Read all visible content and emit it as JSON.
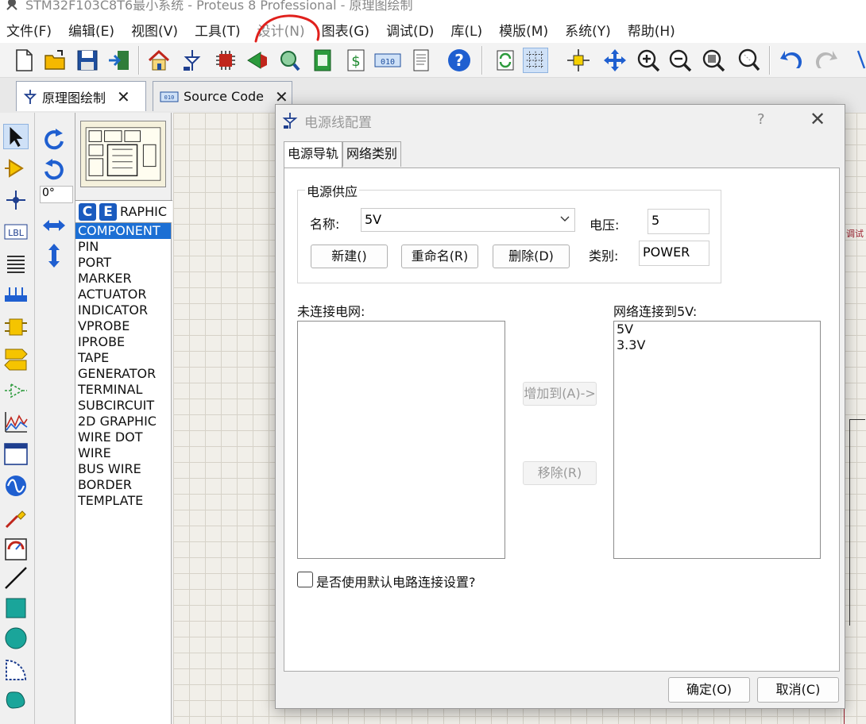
{
  "window": {
    "title": "STM32F103C8T6最小系统 - Proteus 8 Professional - 原理图绘制"
  },
  "menu": [
    "文件(F)",
    "编辑(E)",
    "视图(V)",
    "工具(T)",
    "设计(N)",
    "图表(G)",
    "调试(D)",
    "库(L)",
    "模版(M)",
    "系统(Y)",
    "帮助(H)"
  ],
  "toolbar": {
    "icons": [
      "new-file-icon",
      "open-folder-icon",
      "save-icon",
      "import-icon",
      "home-icon",
      "schematic-icon",
      "pcb-icon",
      "3d-viewer-icon",
      "gerber-icon",
      "design-explorer-icon",
      "bill-of-materials-icon",
      "source-code-icon",
      "notes-icon",
      "help-icon",
      "refresh-icon",
      "grid-icon",
      "origin-icon",
      "pan-icon",
      "zoom-in-icon",
      "zoom-out-icon",
      "zoom-all-icon",
      "zoom-area-icon",
      "undo-icon",
      "redo-icon",
      "cut-icon"
    ]
  },
  "tabs": [
    {
      "label": "原理图绘制",
      "active": true
    },
    {
      "label": "Source Code",
      "active": false
    }
  ],
  "sidebar": {
    "angle": "0°"
  },
  "object_selector": {
    "c_button": "C",
    "e_button": "E",
    "header": "RAPHIC",
    "items": [
      "COMPONENT",
      "PIN",
      "PORT",
      "MARKER",
      "ACTUATOR",
      "INDICATOR",
      "VPROBE",
      "IPROBE",
      "TAPE",
      "GENERATOR",
      "TERMINAL",
      "SUBCIRCUIT",
      "2D GRAPHIC",
      "WIRE DOT",
      "WIRE",
      "BUS WIRE",
      "BORDER",
      "TEMPLATE"
    ],
    "selected_index": 0
  },
  "canvas": {
    "right_label": "调试"
  },
  "dialog": {
    "title": "电源线配置",
    "help": "?",
    "tabs": [
      "电源导轨",
      "网络类别"
    ],
    "group_title": "电源供应",
    "name_label": "名称:",
    "name_value": "5V",
    "voltage_label": "电压:",
    "voltage_value": "5",
    "class_label": "类别:",
    "class_value": "POWER",
    "new_button": "新建()",
    "rename_button": "重命名(R)",
    "delete_button": "删除(D)",
    "unconnected_label": "未连接电网:",
    "connected_label": "网络连接到5V:",
    "unconnected_nets": [],
    "connected_nets": [
      "5V",
      "3.3V"
    ],
    "add_button": "增加到(A)->",
    "remove_button": "移除(R)",
    "checkbox_label": "是否使用默认电路连接设置?",
    "ok_button": "确定(O)",
    "cancel_button": "取消(C)"
  }
}
